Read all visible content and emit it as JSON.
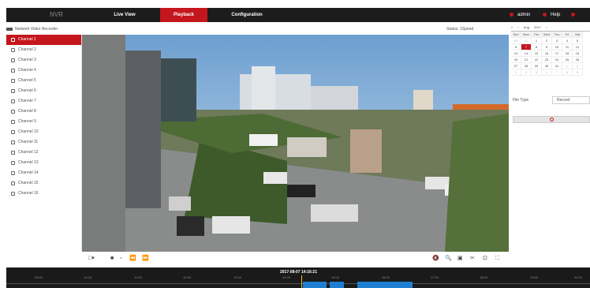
{
  "topbar": {
    "brand": "NVR",
    "nav": [
      "Live View",
      "Playback",
      "Configuration"
    ],
    "user": "admin",
    "help": "Help",
    "logout": "Logout"
  },
  "header": {
    "device": "Network Video Recorder",
    "status": "Status: 1Speed"
  },
  "channels": [
    "Channel 1",
    "Channel 2",
    "Channel 3",
    "Channel 4",
    "Channel 5",
    "Channel 6",
    "Channel 7",
    "Channel 8",
    "Channel 9",
    "Channel 10",
    "Channel 11",
    "Channel 12",
    "Channel 13",
    "Channel 14",
    "Channel 15",
    "Channel 16"
  ],
  "calendar": {
    "month": "Aug",
    "year": "2017",
    "weekdays": [
      "Sun",
      "Mon",
      "Tue",
      "Wed",
      "Thu",
      "Fri",
      "Sat"
    ],
    "weeks": [
      [
        "30",
        "31",
        "1",
        "2",
        "3",
        "4",
        "5"
      ],
      [
        "6",
        "7",
        "8",
        "9",
        "10",
        "11",
        "12"
      ],
      [
        "13",
        "14",
        "15",
        "16",
        "17",
        "18",
        "19"
      ],
      [
        "20",
        "21",
        "22",
        "23",
        "24",
        "25",
        "26"
      ],
      [
        "27",
        "28",
        "29",
        "30",
        "31",
        "1",
        "2"
      ],
      [
        "3",
        "4",
        "5",
        "6",
        "7",
        "8",
        "9"
      ]
    ],
    "selected_day": "7"
  },
  "file_type": {
    "label": "File Type",
    "value": "Record"
  },
  "timeline": {
    "current": "2017-08-07 14:16:21",
    "ticks": [
      "09:00",
      "10:00",
      "11:00",
      "12:00",
      "13:00",
      "14:00",
      "15:00",
      "16:00",
      "17:00",
      "18:00",
      "19:00",
      "20:00"
    ]
  },
  "colors": {
    "accent": "#c4161c",
    "record": "#1e7fd0",
    "cursor": "#f0c000"
  }
}
